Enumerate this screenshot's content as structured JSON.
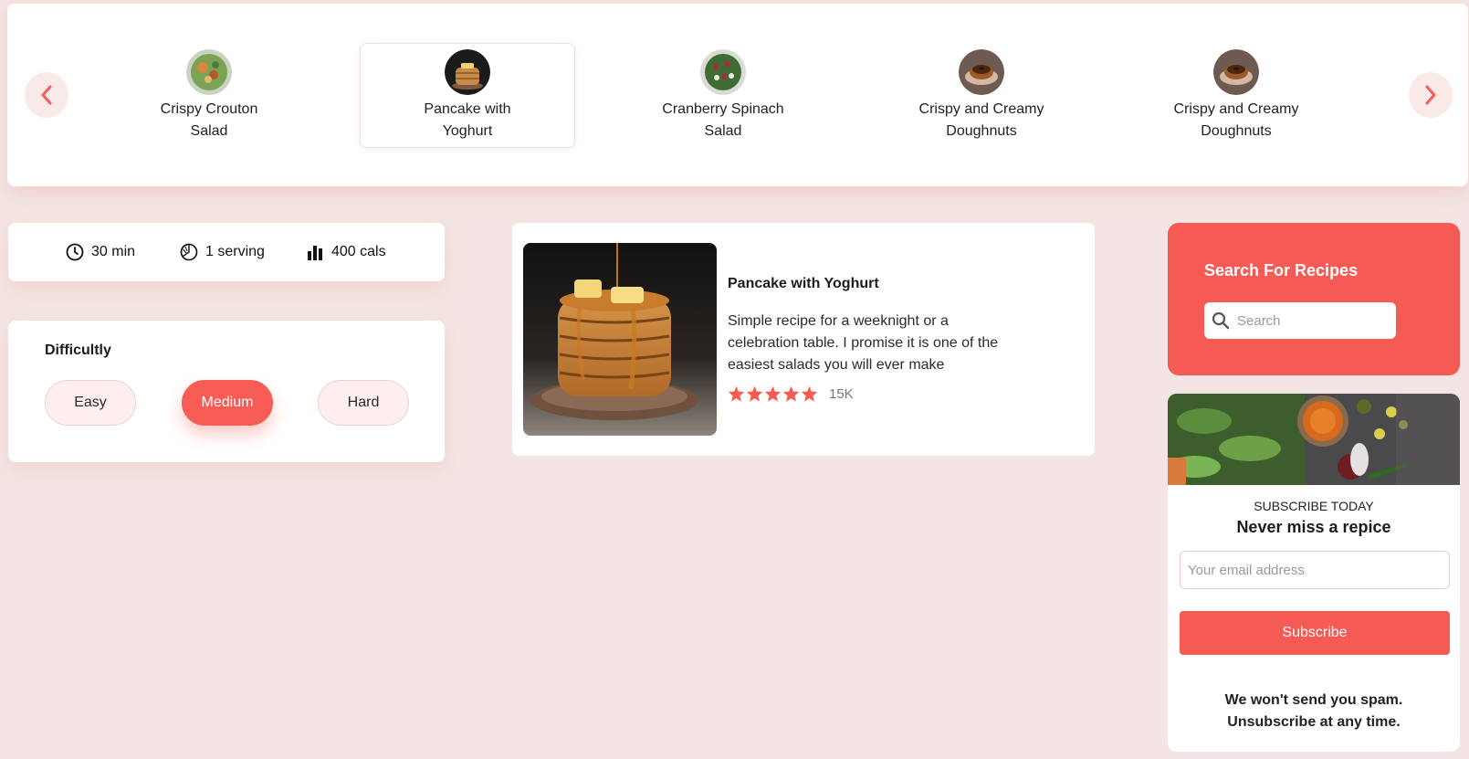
{
  "carousel": {
    "items": [
      {
        "label": "Crispy Crouton Salad",
        "active": false
      },
      {
        "label": "Pancake with Yoghurt",
        "active": true
      },
      {
        "label": "Cranberry Spinach Salad",
        "active": false
      },
      {
        "label": "Crispy and Creamy Doughnuts",
        "active": false
      },
      {
        "label": "Crispy and Creamy Doughnuts",
        "active": false
      }
    ],
    "accent": "#f75c55"
  },
  "stats": {
    "time": "30 min",
    "servings": "1 serving",
    "calories": "400 cals"
  },
  "difficulty": {
    "title": "Difficultly",
    "options": [
      "Easy",
      "Medium",
      "Hard"
    ],
    "selected": "Medium"
  },
  "recipe": {
    "title": "Pancake with Yoghurt",
    "description": "Simple recipe for a weeknight or a celebration table. I promise it is one of the easiest salads you will ever make",
    "rating": 5,
    "rating_count": "15K"
  },
  "search": {
    "title": "Search For Recipes",
    "placeholder": "Search"
  },
  "subscribe": {
    "kicker": "SUBSCRIBE TODAY",
    "title": "Never miss a repice",
    "email_placeholder": "Your email address",
    "button_label": "Subscribe",
    "note_line1": "We won't send you spam.",
    "note_line2": "Unsubscribe at any time."
  }
}
